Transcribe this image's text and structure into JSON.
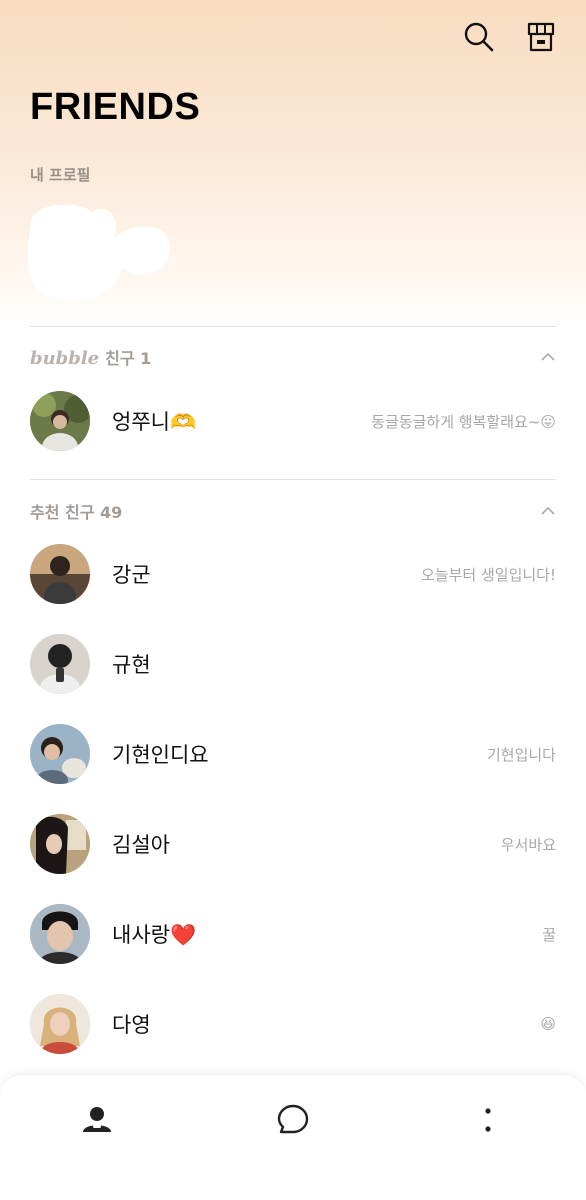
{
  "header": {
    "title": "FRIENDS",
    "icons": [
      "search-icon",
      "store-icon"
    ]
  },
  "my_profile": {
    "label": "내 프로필"
  },
  "bubble_section": {
    "brand": "bubble",
    "title": "친구 1",
    "friends": [
      {
        "name": "엉쭈니🫶",
        "status": "동글동글하게 행복할래요~😛"
      }
    ]
  },
  "recommended_section": {
    "title": "추천 친구 49",
    "friends": [
      {
        "name": "강군",
        "status": "오늘부터 생일입니다!"
      },
      {
        "name": "규현",
        "status": ""
      },
      {
        "name": "기현인디요",
        "status": "기현입니다"
      },
      {
        "name": "김설아",
        "status": "우서바요"
      },
      {
        "name": "내사랑❤️",
        "status": "꿀"
      },
      {
        "name": "다영",
        "status": "😆"
      }
    ]
  },
  "bottom_nav": {
    "items": [
      "friends-tab",
      "chats-tab",
      "more-tab"
    ]
  },
  "colors": {
    "accent_gradient_top": "#f8dcc0",
    "muted_text": "#a8a8a8"
  }
}
